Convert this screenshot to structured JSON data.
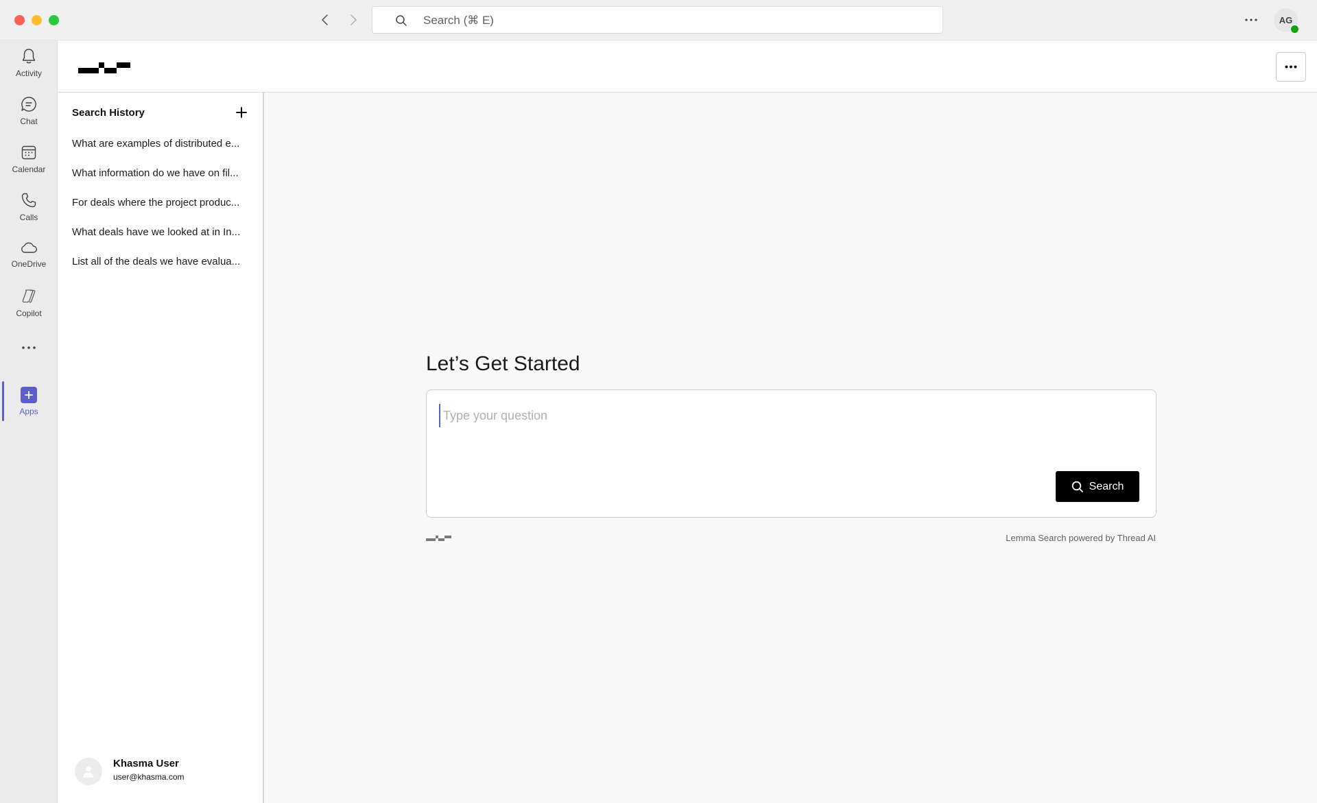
{
  "titlebar": {
    "search_placeholder": "Search (⌘ E)",
    "avatar_initials": "AG"
  },
  "rail": {
    "items": [
      {
        "label": "Activity",
        "icon": "bell-icon"
      },
      {
        "label": "Chat",
        "icon": "chat-icon"
      },
      {
        "label": "Calendar",
        "icon": "calendar-icon"
      },
      {
        "label": "Calls",
        "icon": "phone-icon"
      },
      {
        "label": "OneDrive",
        "icon": "cloud-icon"
      },
      {
        "label": "Copilot",
        "icon": "copilot-icon"
      }
    ],
    "apps_label": "Apps",
    "active_color": "#5b5fc7"
  },
  "history": {
    "title": "Search History",
    "items": [
      "What are examples of distributed e...",
      "What information do we have on fil...",
      "For deals where the project produc...",
      "What deals have we looked at in In...",
      "List all of the deals we have evalua..."
    ]
  },
  "user": {
    "name": "Khasma User",
    "email": "user@khasma.com"
  },
  "main": {
    "heading": "Let’s Get Started",
    "placeholder": "Type your question",
    "search_button": "Search",
    "powered_by": "Lemma Search powered by Thread AI"
  }
}
